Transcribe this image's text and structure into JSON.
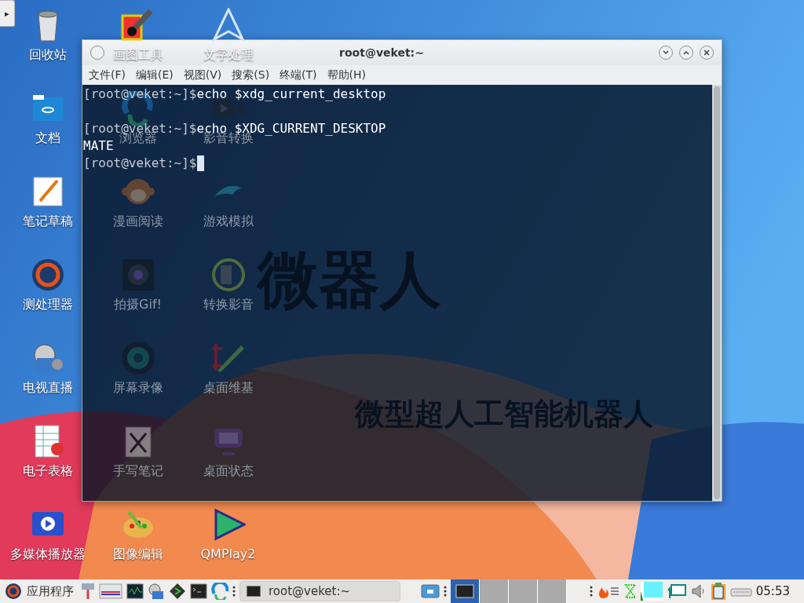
{
  "panel_toggle": {
    "glyph": "▸"
  },
  "desktop_icon_columns": [
    {
      "icons": [
        {
          "label": "回收站"
        },
        {
          "label": "文档"
        },
        {
          "label": "笔记草稿"
        },
        {
          "label": "测处理器"
        },
        {
          "label": "电视直播"
        },
        {
          "label": "电子表格"
        },
        {
          "label": "多媒体播放器"
        }
      ]
    },
    {
      "icons": [
        {
          "label": "画图工具"
        },
        {
          "label": "浏览器"
        },
        {
          "label": "漫画阅读"
        },
        {
          "label": "拍摄Gif!"
        },
        {
          "label": "屏幕录像"
        },
        {
          "label": "手写笔记"
        },
        {
          "label": "图像编辑"
        }
      ]
    },
    {
      "icons": [
        {
          "label": "文字处理"
        },
        {
          "label": "影音转换"
        },
        {
          "label": "游戏模拟"
        },
        {
          "label": "转换影音"
        },
        {
          "label": "桌面维基"
        },
        {
          "label": "桌面状态"
        },
        {
          "label": "QMPlay2"
        }
      ]
    }
  ],
  "wallpaper": {
    "headline": "微器人",
    "subtitle": "微型超人工智能机器人"
  },
  "terminal": {
    "title": "root@veket:~",
    "menu": [
      "文件(F)",
      "编辑(E)",
      "视图(V)",
      "搜索(S)",
      "终端(T)",
      "帮助(H)"
    ],
    "lines": [
      {
        "kind": "command",
        "prompt": "[root@veket:~]$",
        "text": "echo $xdg_current_desktop"
      },
      {
        "kind": "blank"
      },
      {
        "kind": "command",
        "prompt": "[root@veket:~]$",
        "text": "echo $XDG_CURRENT_DESKTOP"
      },
      {
        "kind": "output",
        "text": "MATE"
      },
      {
        "kind": "cursor",
        "prompt": "[root@veket:~]$"
      }
    ]
  },
  "taskbar": {
    "menu_label": "应用程序",
    "tasks": [
      {
        "label": "root@veket:~",
        "selected": false
      }
    ],
    "workspaces": [
      {
        "selected": true
      },
      {
        "selected": false
      },
      {
        "selected": false
      },
      {
        "selected": false
      }
    ],
    "clock": "05:53"
  }
}
